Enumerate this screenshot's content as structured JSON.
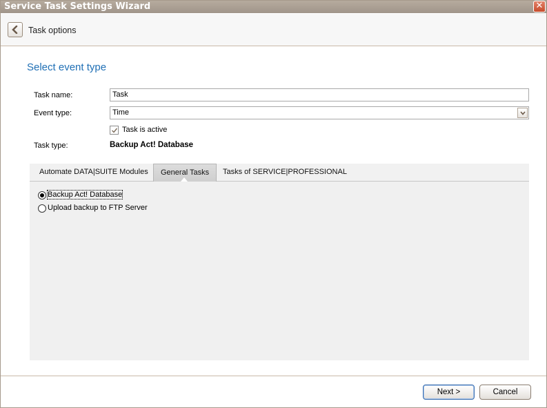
{
  "window": {
    "title": "Service Task Settings Wizard",
    "close_glyph": "✕"
  },
  "header": {
    "title": "Task options",
    "back_icon": "chevron-left-icon"
  },
  "section": {
    "title": "Select event type"
  },
  "form": {
    "task_name_label": "Task name:",
    "task_name_value": "Task",
    "event_type_label": "Event type:",
    "event_type_value": "Time",
    "task_active_label": "Task is active",
    "task_active_checked": true,
    "task_type_label": "Task type:",
    "task_type_value": "Backup Act! Database"
  },
  "tabs": [
    {
      "label": "Automate DATA|SUITE Modules",
      "active": false
    },
    {
      "label": "General Tasks",
      "active": true
    },
    {
      "label": "Tasks of SERVICE|PROFESSIONAL",
      "active": false
    }
  ],
  "general_tasks": {
    "options": [
      {
        "label": "Backup Act! Database",
        "selected": true
      },
      {
        "label": "Upload backup to FTP Server",
        "selected": false
      }
    ]
  },
  "footer": {
    "next_label": "Next >",
    "cancel_label": "Cancel"
  },
  "colors": {
    "accent": "#1f6fb5",
    "titlebar": "#a69a8c",
    "close": "#c74b2c"
  }
}
